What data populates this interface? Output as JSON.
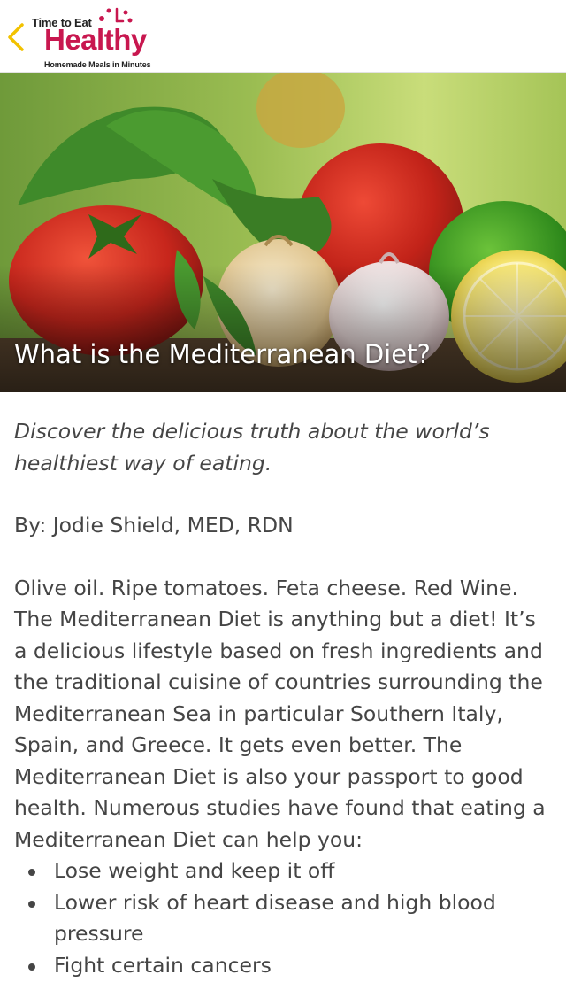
{
  "header": {
    "back_icon": "chevron-left-icon",
    "logo": {
      "line1": "Time to Eat",
      "main": "Healthy",
      "tagline": "Homemade Meals in Minutes"
    },
    "colors": {
      "accent": "#f2c200",
      "brand": "#c8174f"
    }
  },
  "hero": {
    "title": "What is the Mediterranean Diet?"
  },
  "article": {
    "subtitle": "Discover the delicious truth about the world’s healthiest way of eating.",
    "byline": "By: Jodie Shield, MED, RDN",
    "body": "Olive oil. Ripe tomatoes. Feta cheese. Red Wine. The Mediterranean Diet is anything but a diet! It’s a delicious lifestyle based on fresh ingredients and the traditional cuisine of countries surrounding the Mediterranean Sea in particular Southern Italy, Spain, and Greece. It gets even better. The Mediterranean Diet is also your passport to good health. Numerous studies have found that eating a Mediterranean Diet can help you:",
    "bullets": [
      "Lose weight and keep it off",
      "Lower risk of heart disease and high blood pressure",
      "Fight certain cancers"
    ]
  }
}
